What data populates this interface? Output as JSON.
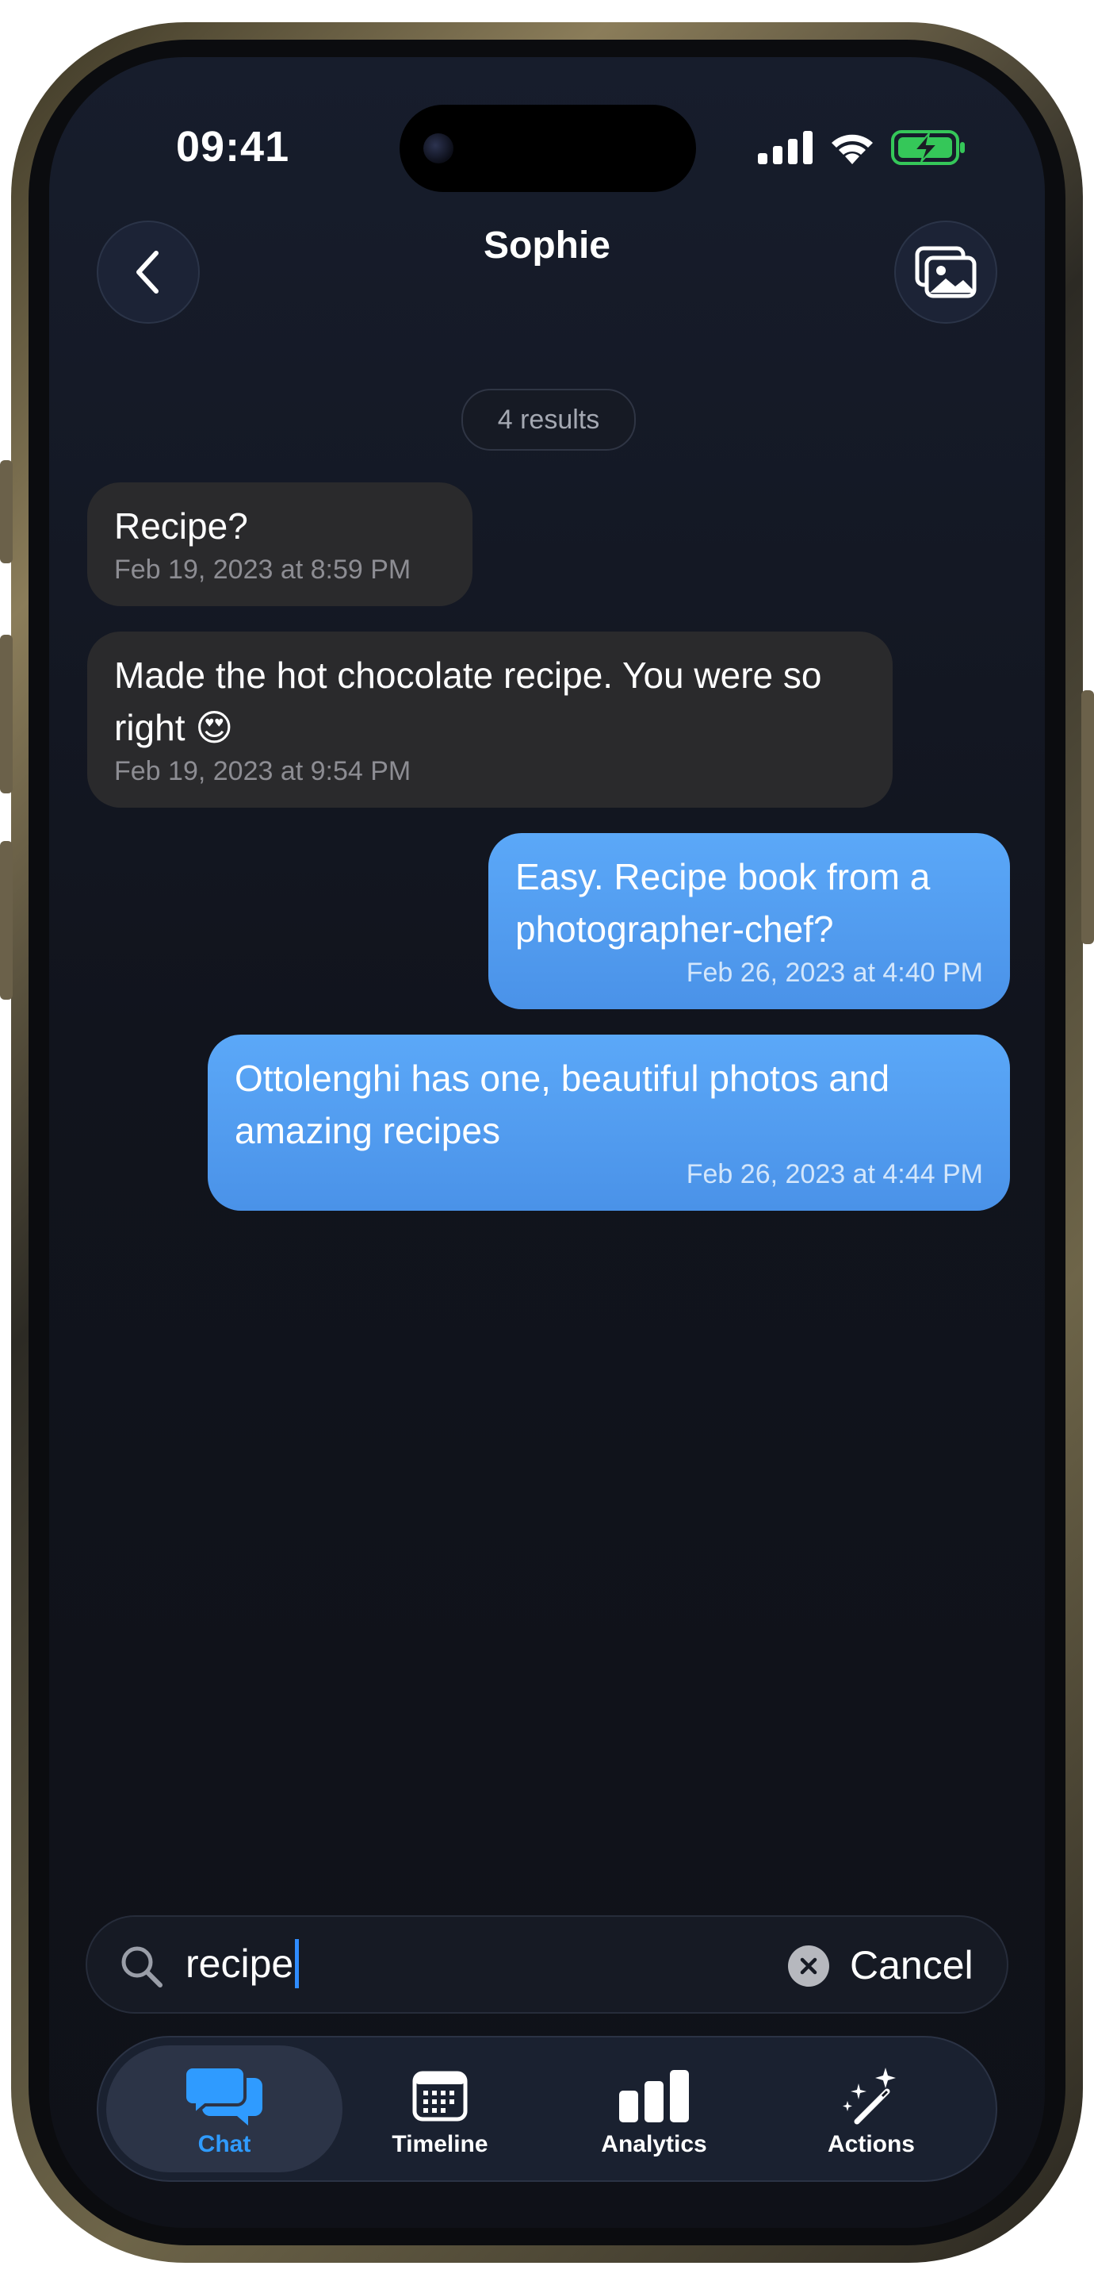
{
  "status_bar": {
    "time": "09:41"
  },
  "header": {
    "title": "Sophie"
  },
  "search_results": {
    "count_label": "4 results"
  },
  "messages": [
    {
      "direction": "incoming",
      "text": "Recipe?",
      "timestamp": "Feb 19, 2023 at 8:59 PM"
    },
    {
      "direction": "incoming",
      "text": "Made the hot chocolate recipe. You were so right 😍",
      "timestamp": "Feb 19, 2023 at 9:54 PM"
    },
    {
      "direction": "outgoing",
      "text": "Easy. Recipe book from a photographer-chef?",
      "timestamp": "Feb 26, 2023 at 4:40 PM"
    },
    {
      "direction": "outgoing",
      "text": "Ottolenghi has one, beautiful photos and amazing recipes",
      "timestamp": "Feb 26, 2023 at 4:44 PM"
    }
  ],
  "search": {
    "value": "recipe",
    "cancel_label": "Cancel"
  },
  "tabbar": {
    "tabs": [
      {
        "label": "Chat",
        "icon": "chat-bubbles-icon",
        "active": true
      },
      {
        "label": "Timeline",
        "icon": "calendar-icon",
        "active": false
      },
      {
        "label": "Analytics",
        "icon": "bar-chart-icon",
        "active": false
      },
      {
        "label": "Actions",
        "icon": "magic-wand-icon",
        "active": false
      }
    ]
  },
  "colors": {
    "accent": "#2f9bff",
    "outgoing_bubble": "#4f9df0",
    "incoming_bubble": "#2a2a2c",
    "background": "#11141d",
    "battery": "#35c759"
  }
}
